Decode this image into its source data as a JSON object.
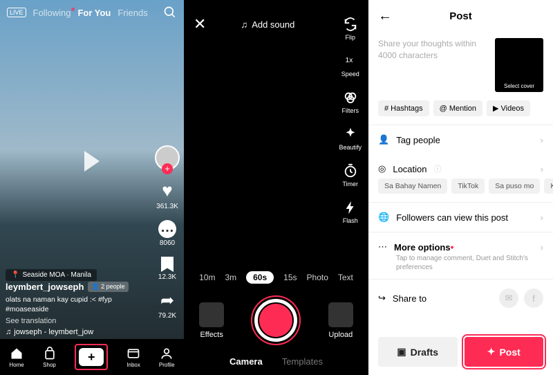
{
  "feed": {
    "nav": {
      "live": "LIVE",
      "following": "Following",
      "for_you": "For You",
      "friends": "Friends"
    },
    "location": "Seaside MOA · Manila",
    "username": "leymbert_jowseph",
    "people_count": "2 people",
    "caption": "olats na naman kay cupid :<  #fyp #moaseaside",
    "translate": "See translation",
    "music": "jowseph - leymbert_jow",
    "rail": {
      "likes": "361.3K",
      "comments": "8060",
      "bookmarks": "12.3K",
      "shares": "79.2K"
    },
    "bottom": [
      "Home",
      "Shop",
      "",
      "Inbox",
      "Profile"
    ]
  },
  "camera": {
    "add_sound": "Add sound",
    "tools": [
      "Flip",
      "Speed",
      "Filters",
      "Beautify",
      "Timer",
      "Flash"
    ],
    "durations": [
      "10m",
      "3m",
      "60s",
      "15s",
      "Photo",
      "Text"
    ],
    "active_duration": "60s",
    "effects": "Effects",
    "upload": "Upload",
    "modes": [
      "Camera",
      "Templates"
    ]
  },
  "post": {
    "title": "Post",
    "placeholder": "Share your thoughts within 4000 characters",
    "cover": "Select cover",
    "chips": [
      "# Hashtags",
      "@ Mention",
      "▶ Videos"
    ],
    "tag_people": "Tag people",
    "location": "Location",
    "loc_sugs": [
      "Sa Bahay Namen",
      "TikTok",
      "Sa puso mo",
      "KAHIT SA"
    ],
    "visibility": "Followers can view this post",
    "more": "More options",
    "more_sub": "Tap to manage comment, Duet and Stitch's preferences",
    "share_to": "Share to",
    "drafts": "Drafts",
    "post_btn": "Post"
  }
}
